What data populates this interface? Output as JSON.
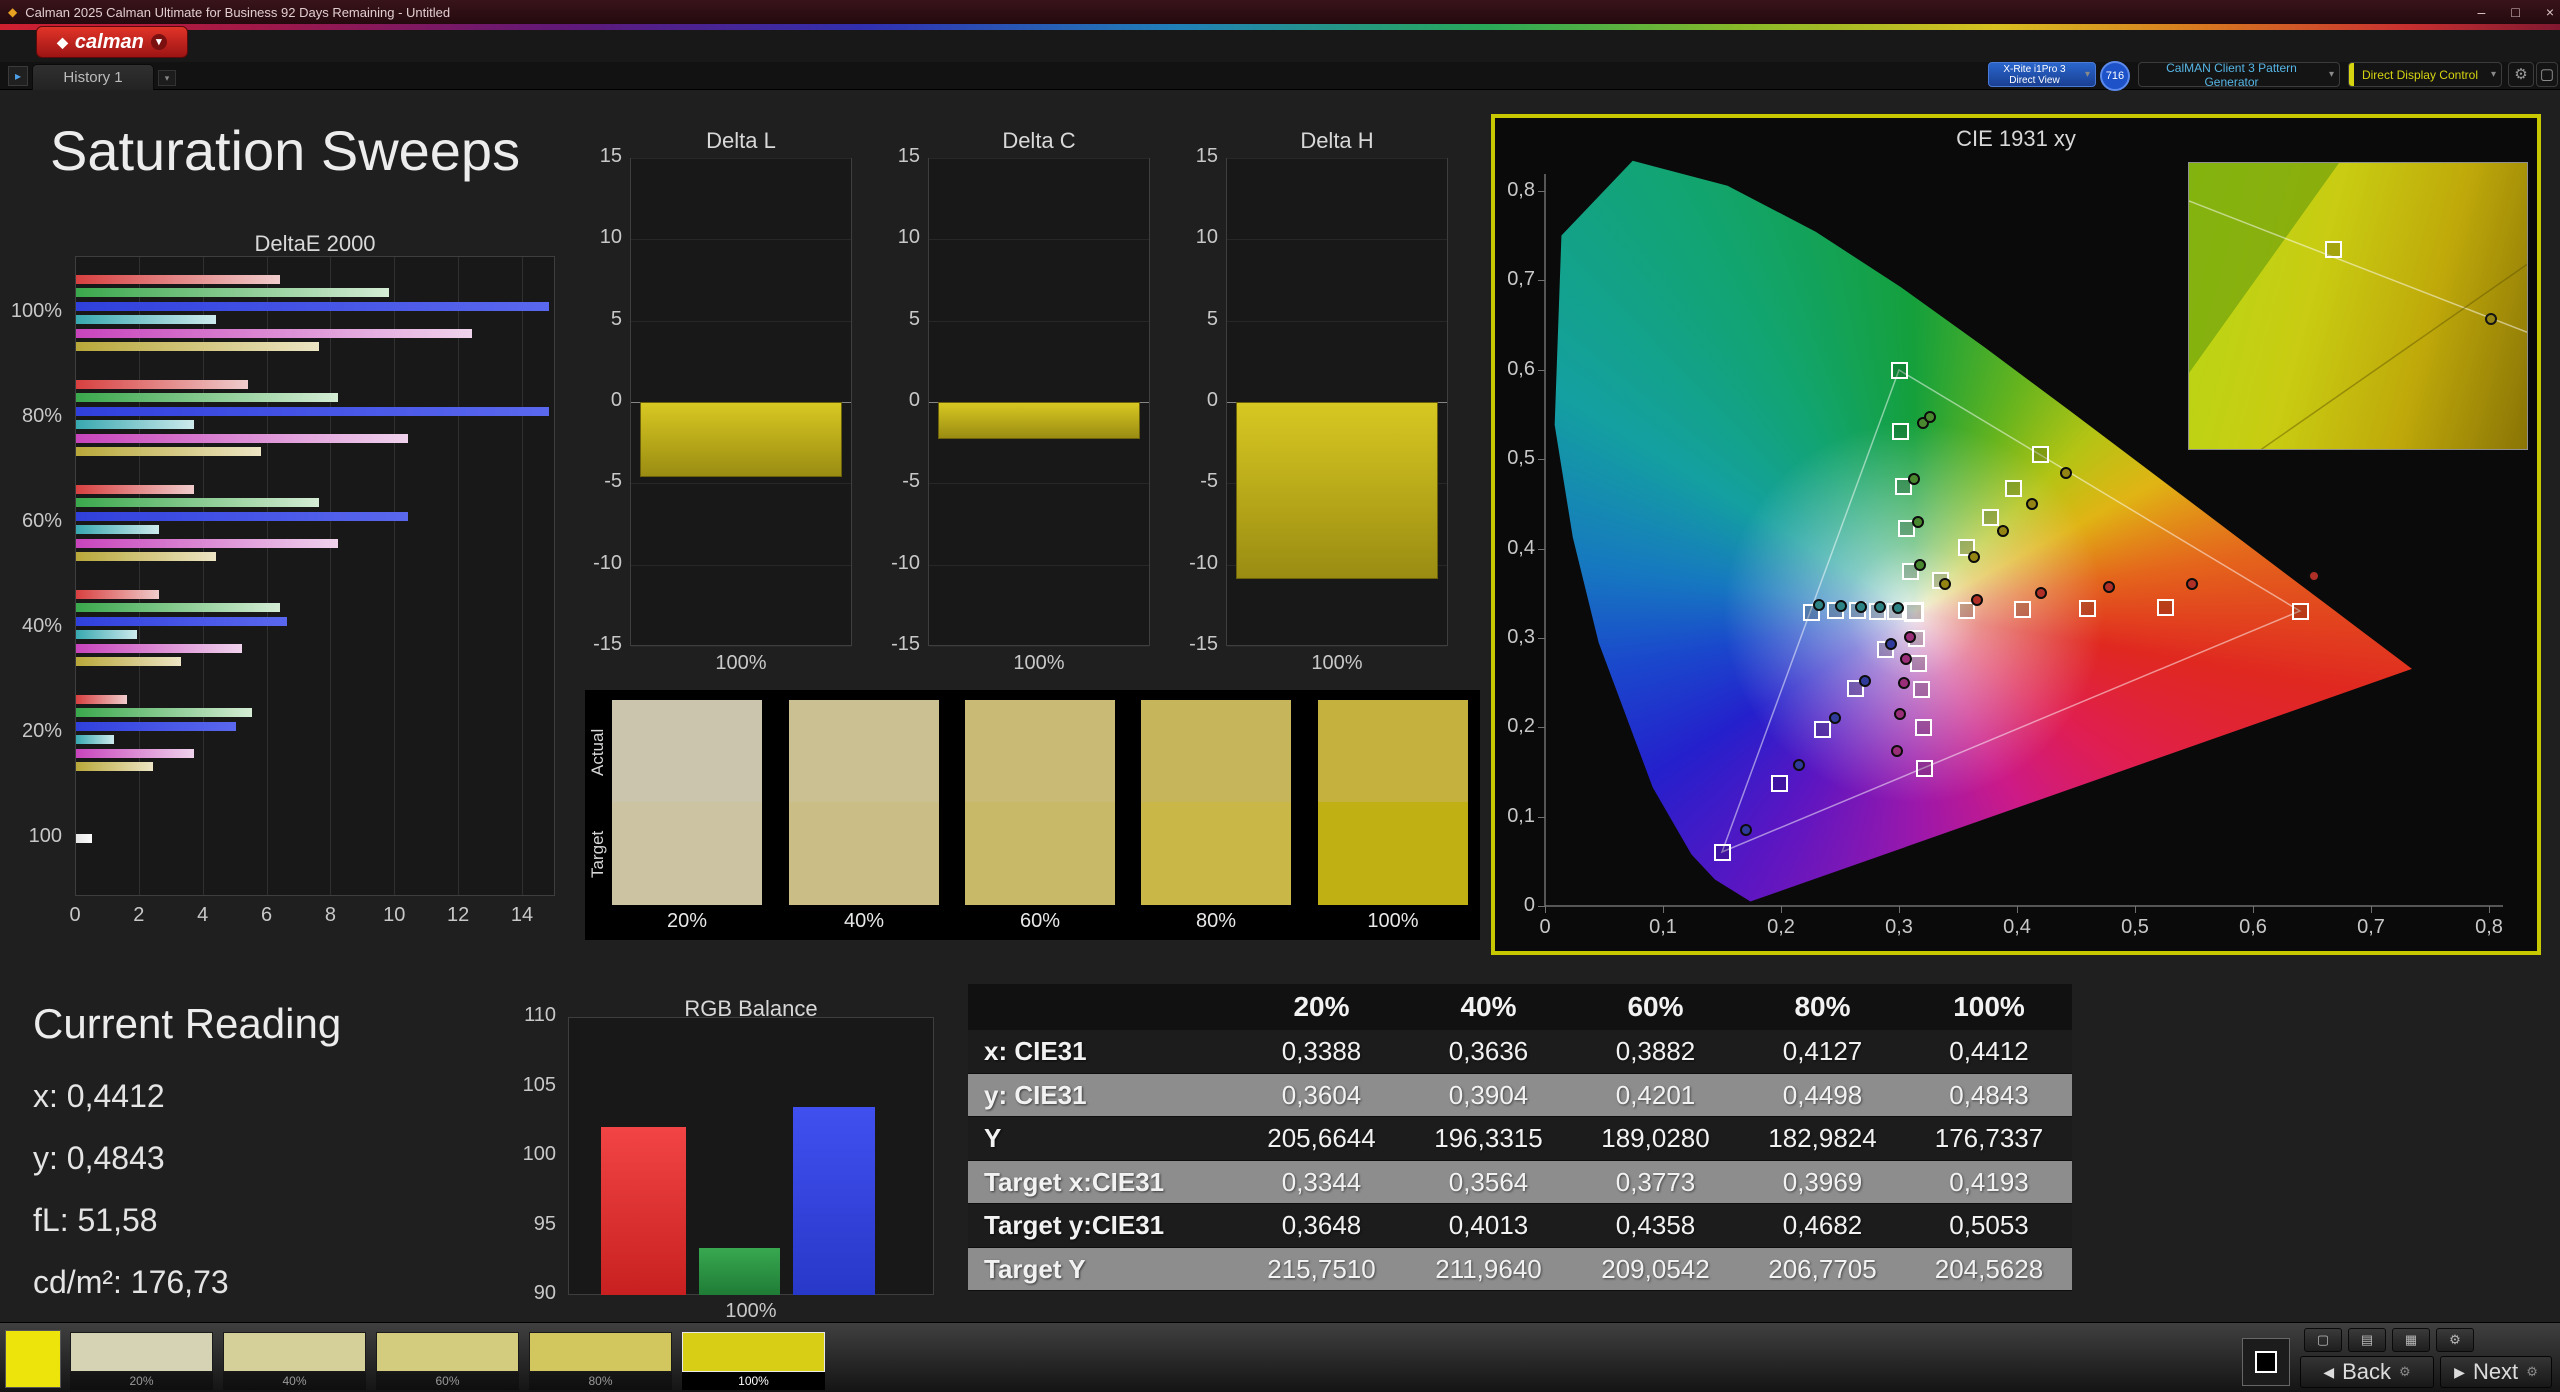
{
  "window": {
    "title": "Calman 2025 Calman Ultimate for Business 92 Days Remaining  - Untitled"
  },
  "icons": {
    "diamond": "◆",
    "chevron": "▾",
    "gear": "⚙",
    "window": "▢",
    "grid": "▤",
    "pattern": "▦",
    "nav_arrow": "▸",
    "back_arrow": "◀",
    "next_arrow": "▶",
    "minimize": "–",
    "maximize": "□",
    "close": "×"
  },
  "toolbar": {
    "logo_text": "calman",
    "history_tab": "History 1",
    "meter": {
      "line1": "X-Rite i1Pro 3",
      "line2": "Direct View"
    },
    "badge": "716",
    "pattern_generator": "CalMAN Client 3 Pattern Generator",
    "display_control": "Direct Display Control"
  },
  "page_title": "Saturation Sweeps",
  "chart_data": [
    {
      "id": "deltae2000",
      "type": "bar",
      "orientation": "horizontal",
      "title": "DeltaE 2000",
      "xlim": [
        0,
        14
      ],
      "xticks": [
        0,
        2,
        4,
        6,
        8,
        10,
        12,
        14
      ],
      "groups": [
        "100%",
        "80%",
        "60%",
        "40%",
        "20%",
        "100"
      ],
      "series": [
        "red",
        "green",
        "blue",
        "cyan",
        "magenta",
        "yellow"
      ],
      "values": [
        [
          6.4,
          9.8,
          14.8,
          4.4,
          12.4,
          7.6
        ],
        [
          5.4,
          8.2,
          14.8,
          3.7,
          10.4,
          5.8
        ],
        [
          3.7,
          7.6,
          10.4,
          2.6,
          8.2,
          4.4
        ],
        [
          2.6,
          6.4,
          6.6,
          1.9,
          5.2,
          3.3
        ],
        [
          1.6,
          5.5,
          5.0,
          1.2,
          3.7,
          2.4
        ],
        [
          0.5
        ]
      ]
    },
    {
      "id": "deltaL",
      "type": "bar",
      "title": "Delta L",
      "ylim": [
        -15,
        15
      ],
      "yticks": [
        15,
        10,
        5,
        0,
        -5,
        -10,
        -15
      ],
      "categories": [
        "100%"
      ],
      "values": [
        -4.6
      ]
    },
    {
      "id": "deltaC",
      "type": "bar",
      "title": "Delta C",
      "ylim": [
        -15,
        15
      ],
      "yticks": [
        15,
        10,
        5,
        0,
        -5,
        -10,
        -15
      ],
      "categories": [
        "100%"
      ],
      "values": [
        -2.3
      ]
    },
    {
      "id": "deltaH",
      "type": "bar",
      "title": "Delta H",
      "ylim": [
        -15,
        15
      ],
      "yticks": [
        15,
        10,
        5,
        0,
        -5,
        -10,
        -15
      ],
      "categories": [
        "100%"
      ],
      "values": [
        -10.9
      ]
    },
    {
      "id": "rgb_balance",
      "type": "bar",
      "title": "RGB Balance",
      "ylim": [
        90,
        110
      ],
      "yticks": [
        110,
        105,
        100,
        95,
        90
      ],
      "categories": [
        "100%"
      ],
      "series": [
        {
          "name": "red",
          "value": 102.1
        },
        {
          "name": "green",
          "value": 93.4
        },
        {
          "name": "blue",
          "value": 103.5
        }
      ]
    },
    {
      "id": "cie1931",
      "type": "scatter",
      "title": "CIE 1931 xy",
      "xlim": [
        0,
        0.8
      ],
      "ylim": [
        0,
        0.8
      ],
      "xticks": [
        "0",
        "0,1",
        "0,2",
        "0,3",
        "0,4",
        "0,5",
        "0,6",
        "0,7",
        "0,8"
      ],
      "yticks": [
        "0,8",
        "0,7",
        "0,6",
        "0,5",
        "0,4",
        "0,3",
        "0,2",
        "0,1",
        "0"
      ],
      "white_point": [
        0.3127,
        0.329
      ],
      "targets": {
        "red": [
          [
            0.357,
            0.331
          ],
          [
            0.404,
            0.332
          ],
          [
            0.459,
            0.333
          ],
          [
            0.525,
            0.334
          ],
          [
            0.64,
            0.33
          ]
        ],
        "green": [
          [
            0.309,
            0.375
          ],
          [
            0.306,
            0.423
          ],
          [
            0.303,
            0.47
          ],
          [
            0.301,
            0.532
          ],
          [
            0.3,
            0.6
          ]
        ],
        "blue": [
          [
            0.288,
            0.287
          ],
          [
            0.263,
            0.244
          ],
          [
            0.235,
            0.198
          ],
          [
            0.198,
            0.138
          ],
          [
            0.15,
            0.06
          ]
        ],
        "cyan": [
          [
            0.297,
            0.33
          ],
          [
            0.281,
            0.33
          ],
          [
            0.264,
            0.331
          ],
          [
            0.246,
            0.331
          ],
          [
            0.225,
            0.329
          ]
        ],
        "magenta": [
          [
            0.3145,
            0.3
          ],
          [
            0.3165,
            0.272
          ],
          [
            0.3185,
            0.243
          ],
          [
            0.32,
            0.2
          ],
          [
            0.321,
            0.154
          ]
        ],
        "yellow": [
          [
            0.3344,
            0.3648
          ],
          [
            0.3564,
            0.4013
          ],
          [
            0.3773,
            0.4358
          ],
          [
            0.3969,
            0.4682
          ],
          [
            0.4193,
            0.5053
          ]
        ]
      },
      "measurements": {
        "red": [
          [
            0.366,
            0.342
          ],
          [
            0.42,
            0.35
          ],
          [
            0.478,
            0.357
          ],
          [
            0.548,
            0.36
          ],
          [
            0.652,
            0.369
          ]
        ],
        "green": [
          [
            0.318,
            0.381
          ],
          [
            0.316,
            0.43
          ],
          [
            0.313,
            0.478
          ],
          [
            0.32,
            0.54
          ],
          [
            0.326,
            0.547
          ]
        ],
        "blue": [
          [
            0.293,
            0.293
          ],
          [
            0.271,
            0.252
          ],
          [
            0.246,
            0.21
          ],
          [
            0.215,
            0.158
          ],
          [
            0.17,
            0.085
          ]
        ],
        "cyan": [
          [
            0.299,
            0.333
          ],
          [
            0.284,
            0.334
          ],
          [
            0.268,
            0.335
          ],
          [
            0.251,
            0.336
          ],
          [
            0.232,
            0.337
          ]
        ],
        "magenta": [
          [
            0.309,
            0.301
          ],
          [
            0.306,
            0.276
          ],
          [
            0.304,
            0.25
          ],
          [
            0.301,
            0.215
          ],
          [
            0.298,
            0.173
          ]
        ],
        "yellow": [
          [
            0.3388,
            0.3604
          ],
          [
            0.3636,
            0.3904
          ],
          [
            0.3882,
            0.4201
          ],
          [
            0.4127,
            0.4498
          ],
          [
            0.4412,
            0.4843
          ]
        ]
      }
    }
  ],
  "swatches": {
    "row_labels": [
      "Actual",
      "Target"
    ],
    "columns": [
      {
        "label": "20%",
        "actual": "#ccc5ad",
        "target": "#cbc3a2"
      },
      {
        "label": "40%",
        "actual": "#cbc092",
        "target": "#cabe86"
      },
      {
        "label": "60%",
        "actual": "#c9ba76",
        "target": "#c8b968"
      },
      {
        "label": "80%",
        "actual": "#c7b55b",
        "target": "#c9b748"
      },
      {
        "label": "100%",
        "actual": "#c5b13d",
        "target": "#c0b013"
      }
    ]
  },
  "current_reading": {
    "title": "Current Reading",
    "lines": [
      "x: 0,4412",
      "y: 0,4843",
      "fL: 51,58",
      "cd/m²: 176,73"
    ]
  },
  "table": {
    "col_headers": [
      "20%",
      "40%",
      "60%",
      "80%",
      "100%"
    ],
    "rows": [
      {
        "label": "x: CIE31",
        "shade": "dark",
        "values": [
          "0,3388",
          "0,3636",
          "0,3882",
          "0,4127",
          "0,4412"
        ]
      },
      {
        "label": "y: CIE31",
        "shade": "gray",
        "values": [
          "0,3604",
          "0,3904",
          "0,4201",
          "0,4498",
          "0,4843"
        ]
      },
      {
        "label": "Y",
        "shade": "dark",
        "values": [
          "205,6644",
          "196,3315",
          "189,0280",
          "182,9824",
          "176,7337"
        ]
      },
      {
        "label": "Target x:CIE31",
        "shade": "gray",
        "values": [
          "0,3344",
          "0,3564",
          "0,3773",
          "0,3969",
          "0,4193"
        ]
      },
      {
        "label": "Target y:CIE31",
        "shade": "dark",
        "values": [
          "0,3648",
          "0,4013",
          "0,4358",
          "0,4682",
          "0,5053"
        ]
      },
      {
        "label": "Target Y",
        "shade": "gray",
        "values": [
          "215,7510",
          "211,9640",
          "209,0542",
          "206,7705",
          "204,5628"
        ]
      }
    ]
  },
  "bottom_bar": {
    "color_patch": "#ece40a",
    "levels": [
      {
        "label": "20%",
        "color": "#d6d2b4",
        "selected": false
      },
      {
        "label": "40%",
        "color": "#d5cf9a",
        "selected": false
      },
      {
        "label": "60%",
        "color": "#d3cb7e",
        "selected": false
      },
      {
        "label": "80%",
        "color": "#d2c75f",
        "selected": false
      },
      {
        "label": "100%",
        "color": "#d8ce16",
        "selected": true
      }
    ],
    "back_label": "Back",
    "next_label": "Next"
  }
}
